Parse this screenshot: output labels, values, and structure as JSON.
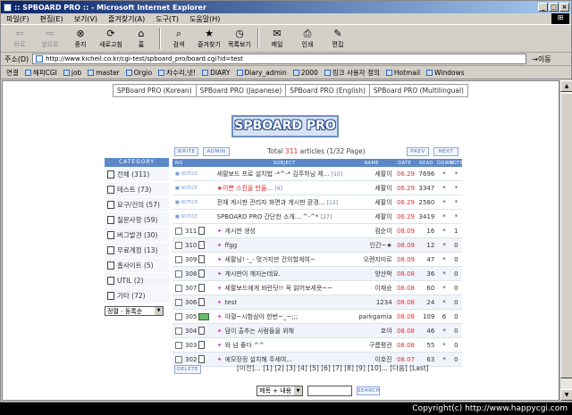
{
  "window": {
    "title": ":: SPBOARD PRO :: - Microsoft Internet Explorer",
    "min": "_",
    "max": "□",
    "close": "×"
  },
  "menu": [
    "파일(F)",
    "편집(E)",
    "보기(V)",
    "즐겨찾기(A)",
    "도구(T)",
    "도움말(H)"
  ],
  "toolbar": [
    {
      "label": "뒤로",
      "icon": "back-arrow-icon",
      "glyph": "⇦",
      "disabled": true
    },
    {
      "label": "앞으로",
      "icon": "forward-arrow-icon",
      "glyph": "⇨",
      "disabled": true
    },
    {
      "label": "중지",
      "icon": "stop-icon",
      "glyph": "⊗"
    },
    {
      "label": "새로고침",
      "icon": "refresh-icon",
      "glyph": "⟳"
    },
    {
      "label": "홈",
      "icon": "home-icon",
      "glyph": "⌂"
    },
    {
      "label": "검색",
      "icon": "search-icon",
      "glyph": "⌕"
    },
    {
      "label": "즐겨찾기",
      "icon": "favorites-icon",
      "glyph": "★"
    },
    {
      "label": "목록보기",
      "icon": "history-icon",
      "glyph": "◷"
    },
    {
      "label": "메일",
      "icon": "mail-icon",
      "glyph": "✉"
    },
    {
      "label": "인쇄",
      "icon": "print-icon",
      "glyph": "⎙"
    },
    {
      "label": "편집",
      "icon": "edit-icon",
      "glyph": "✎"
    }
  ],
  "address": {
    "label": "주소(D)",
    "url": "http://www.kicheil.co.kr/cgi-test/spboard_pro/board.cgi?id=test",
    "go": "이동"
  },
  "links": {
    "label": "연결",
    "items": [
      "해피CGI",
      "job",
      "master",
      "Orgio",
      "차수리,넷!",
      "DIARY",
      "Diary_admin",
      "2000",
      "링크 사용자 정의",
      "Hotmail",
      "Windows"
    ]
  },
  "versions": [
    "SPBoard PRO (Korean)",
    "SPBoard PRO (Japanese)",
    "SPBoard PRO (English)",
    "SPBoard PRO (Multilingual)"
  ],
  "logo_text": "SPBOARD PRO",
  "buttons": {
    "write": "WRITE",
    "admin": "ADMIN",
    "prev": "PREV",
    "next": "NEXT",
    "delete": "DELETE",
    "search": "SEARCH"
  },
  "total": {
    "prefix": "Total",
    "count": "311",
    "suffix": "articles (1/32 Page)"
  },
  "category": {
    "header": "CATEGORY",
    "items": [
      "전체 (311)",
      "테스트 (73)",
      "요구/건의 (57)",
      "질문사항 (59)",
      "버그발견 (30)",
      "무료계정 (13)",
      "홈사이트 (5)",
      "UTIL (2)",
      "기타 (72)"
    ],
    "select": "정렬 - 등록순"
  },
  "table": {
    "headers": {
      "no": "NO",
      "subject": "SUBJECT",
      "name": "NAME",
      "date": "DATE",
      "read": "READ",
      "down": "DOWN",
      "vote": "VOTE"
    },
    "rows": [
      {
        "no": "NOTICE",
        "subject": "세팔보드 프로 설치법 -*^-* 김주하님 제...",
        "comments": "[10]",
        "name": "세팔이",
        "date": "06.29",
        "read": "7696",
        "down": "*",
        "vote": "*",
        "notice": true
      },
      {
        "no": "NOTICE",
        "subject": "★이쁜 스킨을 만들...",
        "comments": "[4]",
        "name": "세팔이",
        "date": "06.29",
        "read": "3347",
        "down": "*",
        "vote": "*",
        "notice": true,
        "red": true
      },
      {
        "no": "NOTICE",
        "subject": "전체 게시판 관리자 화면과 게시판 환경...",
        "comments": "[12]",
        "name": "세팔이",
        "date": "06.29",
        "read": "2580",
        "down": "*",
        "vote": "*",
        "notice": true
      },
      {
        "no": "NOTICE",
        "subject": "SPBOARD PRO 간단한 소개... ^-^*",
        "comments": "[27]",
        "name": "세팔이",
        "date": "06.29",
        "read": "3419",
        "down": "*",
        "vote": "*",
        "notice": true
      },
      {
        "no": "311",
        "subject": "게시판 생성",
        "comments": "",
        "name": "컴순이",
        "date": "08.09",
        "read": "16",
        "down": "*",
        "vote": "1"
      },
      {
        "no": "310",
        "subject": "ffgg",
        "comments": "",
        "name": "인간~★",
        "date": "08.09",
        "read": "12",
        "down": "*",
        "vote": "0"
      },
      {
        "no": "309",
        "subject": "세팔님! -_- 멋가지만 건의할게여~",
        "comments": "",
        "name": "오렌지미르",
        "date": "08.09",
        "read": "47",
        "down": "*",
        "vote": "0"
      },
      {
        "no": "308",
        "subject": "게시판이 깨지는데요.",
        "comments": "",
        "name": "양산박",
        "date": "08.08",
        "read": "36",
        "down": "*",
        "vote": "0"
      },
      {
        "no": "307",
        "subject": "세팔보드에게 바란닷!! 꼭 읽어보세욧~~",
        "comments": "",
        "name": "이재승",
        "date": "08.08",
        "read": "60",
        "down": "*",
        "vote": "0"
      },
      {
        "no": "306",
        "subject": "test",
        "comments": "",
        "name": "1234",
        "date": "08.08",
        "read": "24",
        "down": "*",
        "vote": "0"
      },
      {
        "no": "305",
        "subject": "야혈~시험삼아 한번~_~;;;",
        "comments": "",
        "name": "parkgamia",
        "date": "08.08",
        "read": "109",
        "down": "6",
        "vote": "0",
        "newdoc": true
      },
      {
        "no": "304",
        "subject": "덤이 출추는 사람들을 위해",
        "comments": "",
        "name": "호야",
        "date": "08.08",
        "read": "46",
        "down": "*",
        "vote": "0"
      },
      {
        "no": "303",
        "subject": "와 넘 좋다 ^^",
        "comments": "",
        "name": "구름평관",
        "date": "08.08",
        "read": "55",
        "down": "*",
        "vote": "0"
      },
      {
        "no": "302",
        "subject": "에모장정 설치해 주세여...",
        "comments": "",
        "name": "이호진",
        "date": "08.07",
        "read": "63",
        "down": "*",
        "vote": "0"
      }
    ]
  },
  "pager": "[이전]... [1] [2] [3] [4] [5] [6] [7] [8] [9] [10]... [다음] [Last]",
  "search": {
    "select": "제목 + 내용"
  },
  "footer": "Copyright(c) http://www.happycgi.com"
}
